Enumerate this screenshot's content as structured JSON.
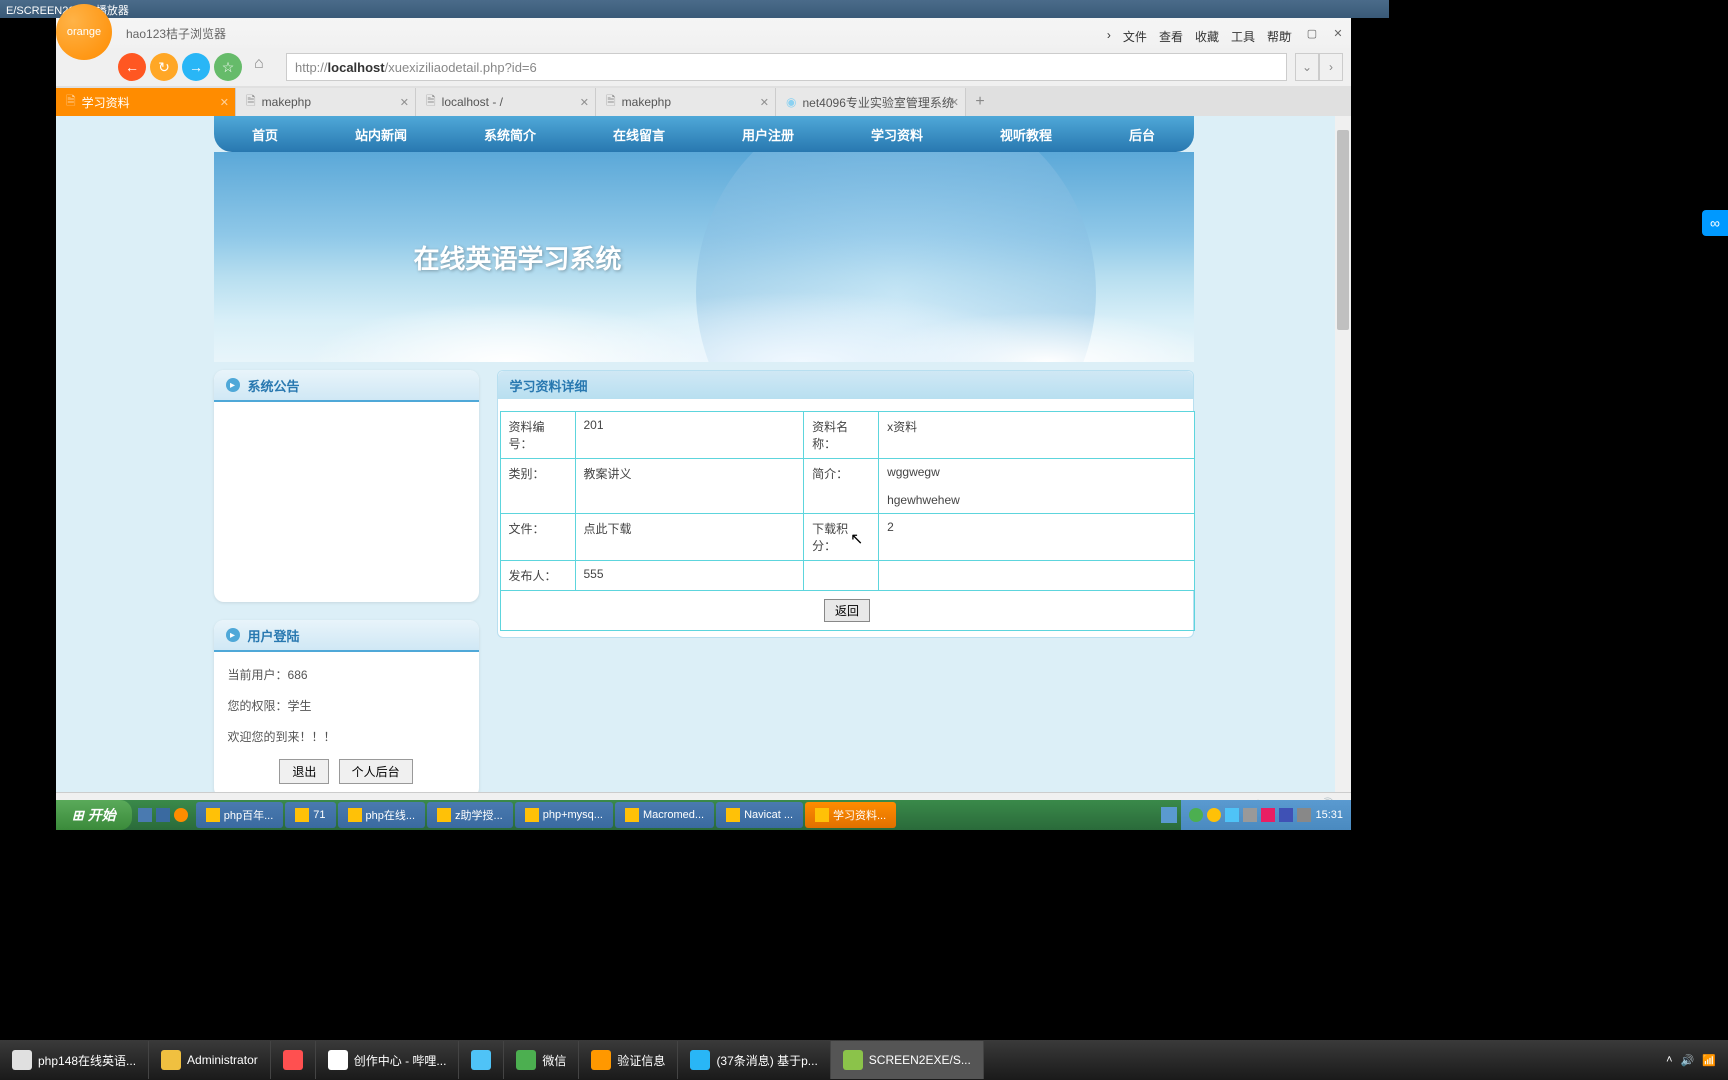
{
  "outer_titlebar": "E/SCREEN2SWF 播放器",
  "browser": {
    "title": "hao123桔子浏览器",
    "logo_text": "orange",
    "menu": [
      "文件",
      "查看",
      "收藏",
      "工具",
      "帮助"
    ],
    "url_prefix": "http://",
    "url_host": "localhost",
    "url_path": "/xuexiziliaodetail.php?id=6",
    "tabs": [
      {
        "label": "学习资料",
        "active": true
      },
      {
        "label": "makephp",
        "active": false
      },
      {
        "label": "localhost - /",
        "active": false
      },
      {
        "label": "makephp",
        "active": false
      },
      {
        "label": "net4096专业实验室管理系统",
        "active": false
      }
    ]
  },
  "nav": [
    "首页",
    "站内新闻",
    "系统简介",
    "在线留言",
    "用户注册",
    "学习资料",
    "视听教程",
    "后台"
  ],
  "banner_title": "在线英语学习系统",
  "sidebar": {
    "announce_title": "系统公告",
    "login_title": "用户登陆",
    "current_user_label": "当前用户：",
    "current_user": "686",
    "role_label": "您的权限：",
    "role": "学生",
    "welcome": "欢迎您的到来！！！",
    "logout_btn": "退出",
    "personal_btn": "个人后台"
  },
  "detail": {
    "header": "学习资料详细",
    "rows": {
      "id_label": "资料编号：",
      "id_value": "201",
      "name_label": "资料名称：",
      "name_value": "x资料",
      "cat_label": "类别：",
      "cat_value": "教案讲义",
      "intro_label": "简介：",
      "intro_value1": "wggwegw",
      "intro_value2": "hgewhwehew",
      "file_label": "文件：",
      "file_value": "点此下载",
      "points_label": "下载积分：",
      "points_value": "2",
      "publisher_label": "发布人：",
      "publisher_value": "555"
    },
    "return_btn": "返回"
  },
  "inner_taskbar": {
    "start": "开始",
    "items": [
      {
        "label": "php百年..."
      },
      {
        "label": "71"
      },
      {
        "label": "php在线..."
      },
      {
        "label": "z助学授..."
      },
      {
        "label": "php+mysq..."
      },
      {
        "label": "Macromed..."
      },
      {
        "label": "Navicat ..."
      },
      {
        "label": "学习资料...",
        "active": true
      }
    ],
    "time": "15:31"
  },
  "outer_taskbar": {
    "items": [
      {
        "label": "php148在线英语...",
        "color": "#e0e0e0"
      },
      {
        "label": "Administrator",
        "color": "#f0c040"
      },
      {
        "label": "",
        "color": "#ff5050"
      },
      {
        "label": "创作中心 - 哔哩...",
        "color": "#ffffff"
      },
      {
        "label": "",
        "color": "#4fc3f7"
      },
      {
        "label": "微信",
        "color": "#4caf50"
      },
      {
        "label": "验证信息",
        "color": "#ff9800"
      },
      {
        "label": "(37条消息) 基于p...",
        "color": "#29b6f6"
      },
      {
        "label": "SCREEN2EXE/S...",
        "color": "#8bc34a",
        "active": true
      }
    ]
  }
}
